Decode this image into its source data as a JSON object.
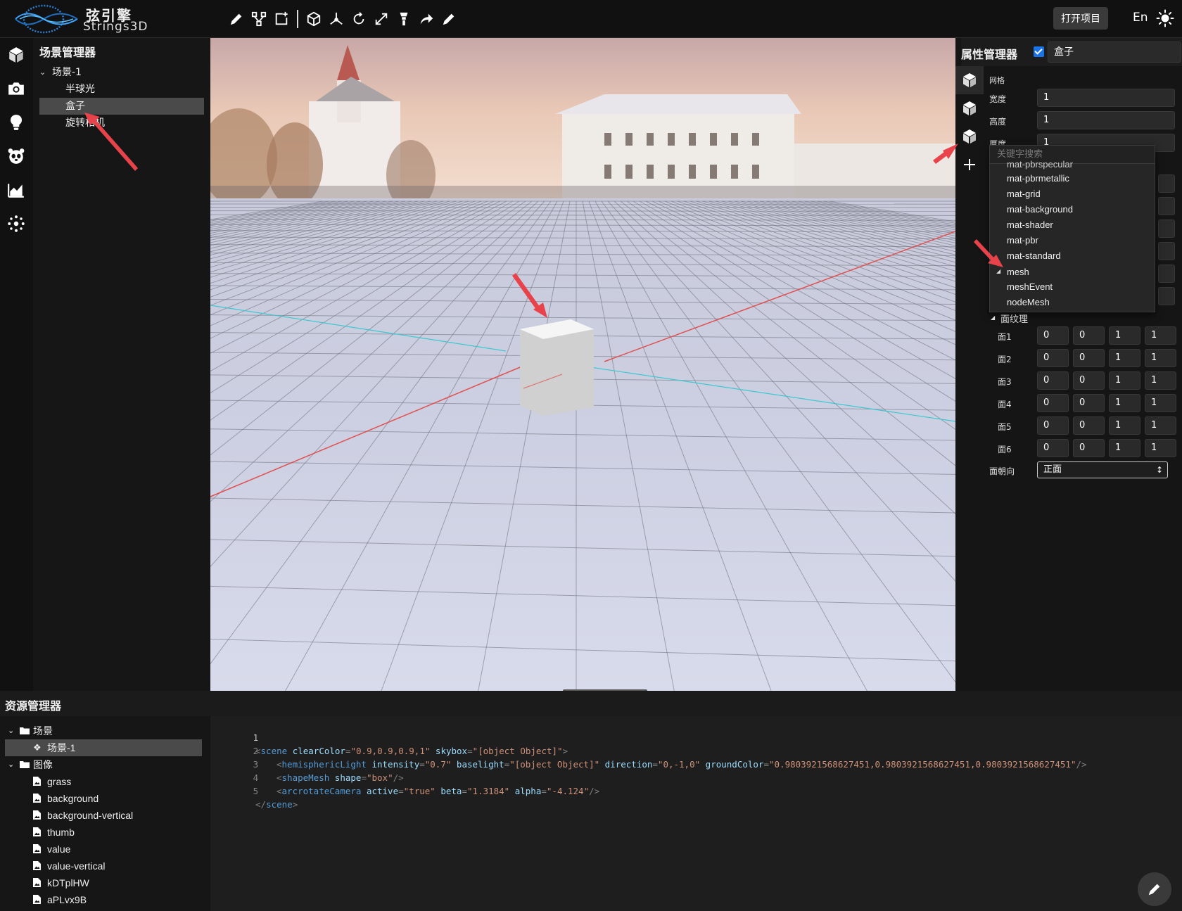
{
  "app": {
    "brand_cn": "弦引擎",
    "brand_en": "Strings3D"
  },
  "toolbar": {
    "tools": [
      "pencil-icon",
      "nodes-icon",
      "add-frame-icon",
      "cube-outline-icon",
      "axes-icon",
      "rotate-icon",
      "scale-icon",
      "spotlight-icon",
      "redo-arrow-icon",
      "edit-icon"
    ],
    "open_project": "打开项目",
    "lang": "En"
  },
  "scene_manager": {
    "title": "场景管理器",
    "root": "场景-1",
    "items": [
      "半球光",
      "盒子",
      "旋转相机"
    ],
    "selected": "盒子"
  },
  "property_manager": {
    "title": "属性管理器",
    "visible_checked": true,
    "object_name": "盒子",
    "section_mesh": "网格",
    "width_label": "宽度",
    "width_value": "1",
    "height_label": "高度",
    "height_value": "1",
    "depth_label": "厚度",
    "depth_value": "1",
    "search_placeholder": "关键字搜索",
    "dropdown_items": [
      "mat-pbrspecular",
      "mat-pbrmetallic",
      "mat-grid",
      "mat-background",
      "mat-shader",
      "mat-pbr",
      "mat-standard",
      "mesh",
      "meshEvent",
      "nodeMesh"
    ],
    "face_uv_label": "面纹理",
    "faces": [
      {
        "label": "面1",
        "values": [
          "0",
          "0",
          "1",
          "1"
        ]
      },
      {
        "label": "面2",
        "values": [
          "0",
          "0",
          "1",
          "1"
        ]
      },
      {
        "label": "面3",
        "values": [
          "0",
          "0",
          "1",
          "1"
        ]
      },
      {
        "label": "面4",
        "values": [
          "0",
          "0",
          "1",
          "1"
        ]
      },
      {
        "label": "面5",
        "values": [
          "0",
          "0",
          "1",
          "1"
        ]
      },
      {
        "label": "面6",
        "values": [
          "0",
          "0",
          "1",
          "1"
        ]
      }
    ],
    "orientation_label": "面朝向",
    "orientation_value": "正面"
  },
  "asset_manager": {
    "title": "资源管理器",
    "folder_scene": "场景",
    "scene_item": "场景-1",
    "folder_image": "图像",
    "images": [
      "grass",
      "background",
      "background-vertical",
      "thumb",
      "value",
      "value-vertical",
      "kDTplHW",
      "aPLvx9B"
    ]
  },
  "code": {
    "line_numbers": [
      "1",
      "2",
      "3",
      "4",
      "5"
    ],
    "l1": {
      "tag": "scene",
      "a1": "clearColor",
      "v1": "\"0.9,0.9,0.9,1\"",
      "a2": "skybox",
      "v2": "\"[object Object]\""
    },
    "l2": {
      "tag": "hemisphericLight",
      "a1": "intensity",
      "v1": "\"0.7\"",
      "a2": "baselight",
      "v2": "\"[object Object]\"",
      "a3": "direction",
      "v3": "\"0,-1,0\"",
      "a4": "groundColor",
      "v4": "\"0.9803921568627451,0.9803921568627451,0.9803921568627451\""
    },
    "l3": {
      "tag": "shapeMesh",
      "a1": "shape",
      "v1": "\"box\""
    },
    "l4": {
      "tag": "arcrotateCamera",
      "a1": "active",
      "v1": "\"true\"",
      "a2": "beta",
      "v2": "\"1.3184\"",
      "a3": "alpha",
      "v3": "\"-4.124\""
    },
    "l5": {
      "tag": "scene"
    }
  },
  "colors": {
    "accent": "#1b73e8",
    "selection": "#4a4a4a",
    "annotation_arrow": "#e8434a",
    "x_axis": "#e05050",
    "z_axis": "#3cc8d0"
  }
}
